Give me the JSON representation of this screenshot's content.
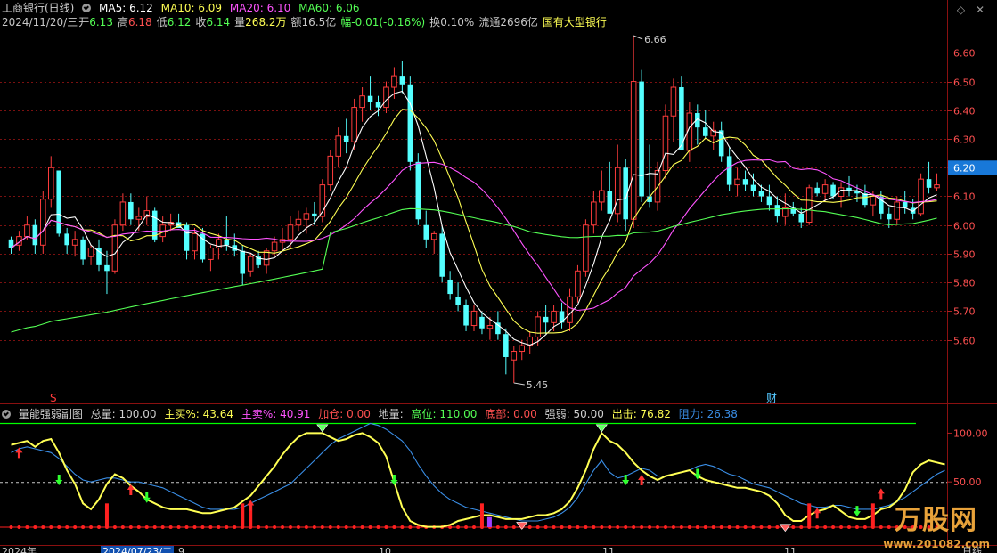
{
  "header": {
    "name": "工商银行(日线)",
    "ma5": "MA5: 6.12",
    "ma10": "MA10: 6.09",
    "ma20": "MA20: 6.10",
    "ma60": "MA60: 6.06",
    "date": "2024/11/20/三",
    "open_label": "开",
    "open": "6.13",
    "high_label": "高",
    "high": "6.18",
    "low_label": "低",
    "low": "6.12",
    "close_label": "收",
    "close": "6.14",
    "vol_label": "量",
    "vol": "268.2万",
    "amt_label": "额",
    "amt": "16.5亿",
    "chg_label": "幅",
    "chg": "-0.01(-0.16%)",
    "turn_label": "换",
    "turn": "0.10%",
    "float_label": "流通",
    "float": "2696亿",
    "tag": "国有大型银行"
  },
  "sub_header": {
    "name": "量能强弱副图",
    "total": "总量: 100.00",
    "main_buy": "主买%: 43.64",
    "main_sell": "主卖%: 40.91",
    "add": "加仓: 0.00",
    "ground": "地量:",
    "high_pos": "高位: 110.00",
    "bottom": "底部: 0.00",
    "strength": "强弱: 50.00",
    "exit": "出击: 76.82",
    "resist": "阻力: 26.38"
  },
  "markers": {
    "s": "S",
    "cai": "财",
    "hi": "6.66",
    "lo": "5.45",
    "price_tag": "6.20"
  },
  "axis_bottom": {
    "year": "2024年",
    "sel_date": "2024/07/23/二",
    "m9": "9",
    "m10": "10",
    "m11": "11",
    "period": "日线"
  },
  "watermark": {
    "brand": "万股网",
    "url": "www.201082.com"
  },
  "icons": {
    "diamond": "diamond-icon",
    "close": "close-icon",
    "settings": "circle-check-icon"
  },
  "colors": {
    "up": "#ff3c3c",
    "down": "#54ffff",
    "ma5": "#ffffff",
    "ma10": "#ffff54",
    "ma20": "#ff54ff",
    "ma60": "#54ff54",
    "strength": "#ffff54",
    "blue": "#3a8ee6",
    "green_line": "#00ff00"
  },
  "chart_data": {
    "type": "candlestick",
    "y_ticks": [
      6.6,
      6.5,
      6.4,
      6.3,
      6.2,
      6.1,
      6.0,
      5.9,
      5.8,
      5.7,
      5.6
    ],
    "y_range": [
      5.45,
      6.66
    ],
    "sub_y_ticks": [
      "100.00",
      "50.00"
    ],
    "sub_y_range": [
      0,
      110
    ],
    "candles": [
      [
        5.95,
        5.96,
        5.9,
        5.92
      ],
      [
        5.93,
        5.98,
        5.91,
        5.96
      ],
      [
        5.96,
        6.03,
        5.95,
        6.0
      ],
      [
        6.0,
        6.02,
        5.9,
        5.93
      ],
      [
        5.93,
        6.12,
        5.9,
        6.09
      ],
      [
        6.09,
        6.24,
        6.06,
        6.2
      ],
      [
        6.19,
        6.19,
        5.96,
        5.97
      ],
      [
        5.97,
        5.99,
        5.9,
        5.93
      ],
      [
        5.93,
        5.98,
        5.89,
        5.95
      ],
      [
        5.95,
        5.96,
        5.86,
        5.88
      ],
      [
        5.89,
        5.93,
        5.86,
        5.92
      ],
      [
        5.92,
        5.95,
        5.84,
        5.86
      ],
      [
        5.86,
        5.91,
        5.76,
        5.84
      ],
      [
        5.84,
        6.02,
        5.83,
        6.0
      ],
      [
        6.0,
        6.11,
        5.98,
        6.08
      ],
      [
        6.08,
        6.11,
        6.0,
        6.02
      ],
      [
        6.02,
        6.06,
        5.98,
        6.03
      ],
      [
        6.03,
        6.1,
        6.0,
        6.05
      ],
      [
        6.05,
        6.06,
        5.94,
        5.95
      ],
      [
        5.96,
        6.03,
        5.94,
        6.0
      ],
      [
        6.0,
        6.04,
        5.98,
        6.01
      ],
      [
        6.01,
        6.04,
        5.99,
        5.99
      ],
      [
        6.0,
        6.01,
        5.88,
        5.91
      ],
      [
        5.91,
        5.99,
        5.88,
        5.97
      ],
      [
        5.97,
        5.99,
        5.87,
        5.88
      ],
      [
        5.88,
        5.93,
        5.84,
        5.92
      ],
      [
        5.92,
        5.97,
        5.88,
        5.95
      ],
      [
        5.95,
        6.03,
        5.91,
        5.93
      ],
      [
        5.93,
        5.97,
        5.89,
        5.91
      ],
      [
        5.91,
        5.93,
        5.79,
        5.83
      ],
      [
        5.84,
        5.9,
        5.82,
        5.89
      ],
      [
        5.89,
        5.91,
        5.85,
        5.86
      ],
      [
        5.86,
        5.92,
        5.83,
        5.91
      ],
      [
        5.91,
        5.96,
        5.89,
        5.94
      ],
      [
        5.94,
        5.99,
        5.91,
        5.95
      ],
      [
        5.95,
        6.03,
        5.92,
        6.0
      ],
      [
        6.0,
        6.05,
        5.98,
        6.02
      ],
      [
        6.02,
        6.06,
        5.97,
        6.04
      ],
      [
        6.04,
        6.08,
        6.0,
        6.03
      ],
      [
        6.03,
        6.16,
        6.01,
        6.14
      ],
      [
        6.14,
        6.26,
        6.12,
        6.24
      ],
      [
        6.24,
        6.34,
        6.2,
        6.31
      ],
      [
        6.31,
        6.37,
        6.25,
        6.29
      ],
      [
        6.29,
        6.44,
        6.26,
        6.41
      ],
      [
        6.41,
        6.48,
        6.36,
        6.45
      ],
      [
        6.45,
        6.52,
        6.4,
        6.43
      ],
      [
        6.43,
        6.45,
        6.38,
        6.41
      ],
      [
        6.41,
        6.5,
        6.39,
        6.48
      ],
      [
        6.48,
        6.55,
        6.44,
        6.52
      ],
      [
        6.52,
        6.57,
        6.46,
        6.49
      ],
      [
        6.49,
        6.52,
        6.19,
        6.22
      ],
      [
        6.22,
        6.25,
        6.0,
        6.02
      ],
      [
        6.0,
        6.05,
        5.92,
        5.95
      ],
      [
        5.95,
        5.98,
        5.9,
        5.97
      ],
      [
        5.97,
        6.0,
        5.8,
        5.82
      ],
      [
        5.81,
        5.84,
        5.74,
        5.76
      ],
      [
        5.75,
        5.8,
        5.7,
        5.72
      ],
      [
        5.72,
        5.74,
        5.63,
        5.65
      ],
      [
        5.65,
        5.72,
        5.63,
        5.7
      ],
      [
        5.68,
        5.7,
        5.62,
        5.64
      ],
      [
        5.64,
        5.68,
        5.6,
        5.65
      ],
      [
        5.66,
        5.7,
        5.6,
        5.62
      ],
      [
        5.62,
        5.64,
        5.48,
        5.54
      ],
      [
        5.53,
        5.58,
        5.45,
        5.56
      ],
      [
        5.56,
        5.6,
        5.53,
        5.58
      ],
      [
        5.58,
        5.63,
        5.55,
        5.61
      ],
      [
        5.61,
        5.7,
        5.58,
        5.68
      ],
      [
        5.68,
        5.72,
        5.62,
        5.66
      ],
      [
        5.66,
        5.72,
        5.63,
        5.7
      ],
      [
        5.7,
        5.73,
        5.64,
        5.66
      ],
      [
        5.66,
        5.78,
        5.63,
        5.75
      ],
      [
        5.75,
        5.86,
        5.73,
        5.84
      ],
      [
        5.84,
        6.02,
        5.82,
        6.0
      ],
      [
        6.0,
        6.12,
        5.97,
        6.08
      ],
      [
        6.08,
        6.19,
        6.05,
        6.12
      ],
      [
        6.12,
        6.22,
        6.07,
        6.04
      ],
      [
        6.04,
        6.28,
        6.01,
        6.2
      ],
      [
        6.2,
        6.23,
        5.98,
        6.02
      ],
      [
        6.02,
        6.66,
        5.99,
        6.5
      ],
      [
        6.5,
        6.54,
        6.08,
        6.1
      ],
      [
        6.1,
        6.28,
        6.06,
        6.08
      ],
      [
        6.08,
        6.22,
        6.05,
        6.19
      ],
      [
        6.19,
        6.42,
        6.16,
        6.38
      ],
      [
        6.38,
        6.51,
        6.29,
        6.48
      ],
      [
        6.48,
        6.52,
        6.3,
        6.26
      ],
      [
        6.26,
        6.43,
        6.22,
        6.39
      ],
      [
        6.39,
        6.42,
        6.28,
        6.34
      ],
      [
        6.34,
        6.4,
        6.3,
        6.31
      ],
      [
        6.31,
        6.36,
        6.26,
        6.33
      ],
      [
        6.33,
        6.36,
        6.22,
        6.24
      ],
      [
        6.24,
        6.27,
        6.12,
        6.14
      ],
      [
        6.14,
        6.2,
        6.1,
        6.16
      ],
      [
        6.16,
        6.19,
        6.12,
        6.14
      ],
      [
        6.14,
        6.18,
        6.1,
        6.12
      ],
      [
        6.12,
        6.14,
        6.08,
        6.1
      ],
      [
        6.1,
        6.14,
        6.05,
        6.07
      ],
      [
        6.07,
        6.1,
        6.01,
        6.03
      ],
      [
        6.03,
        6.11,
        6.0,
        6.06
      ],
      [
        6.06,
        6.08,
        6.03,
        6.04
      ],
      [
        6.04,
        6.06,
        5.99,
        6.01
      ],
      [
        6.01,
        6.14,
        6.0,
        6.13
      ],
      [
        6.13,
        6.15,
        6.1,
        6.11
      ],
      [
        6.11,
        6.16,
        6.08,
        6.14
      ],
      [
        6.14,
        6.15,
        6.09,
        6.1
      ],
      [
        6.1,
        6.15,
        6.06,
        6.13
      ],
      [
        6.13,
        6.17,
        6.1,
        6.12
      ],
      [
        6.12,
        6.14,
        6.08,
        6.11
      ],
      [
        6.11,
        6.14,
        6.06,
        6.07
      ],
      [
        6.07,
        6.12,
        6.03,
        6.1
      ],
      [
        6.1,
        6.12,
        6.02,
        6.04
      ],
      [
        6.04,
        6.06,
        5.99,
        6.02
      ],
      [
        6.02,
        6.1,
        6.0,
        6.08
      ],
      [
        6.08,
        6.12,
        6.04,
        6.06
      ],
      [
        6.06,
        6.09,
        6.02,
        6.04
      ],
      [
        6.04,
        6.18,
        6.03,
        6.16
      ],
      [
        6.16,
        6.22,
        6.11,
        6.13
      ],
      [
        6.13,
        6.18,
        6.12,
        6.14
      ]
    ],
    "series": [
      {
        "name": "MA5",
        "values": []
      },
      {
        "name": "MA10",
        "values": []
      },
      {
        "name": "MA20",
        "values": []
      },
      {
        "name": "MA60",
        "values": []
      }
    ],
    "strength_line": [
      88,
      90,
      92,
      86,
      92,
      94,
      80,
      62,
      48,
      28,
      22,
      32,
      48,
      58,
      54,
      46,
      40,
      32,
      28,
      24,
      22,
      22,
      22,
      20,
      18,
      18,
      20,
      22,
      24,
      30,
      36,
      46,
      56,
      66,
      78,
      88,
      96,
      100,
      100,
      100,
      96,
      92,
      94,
      98,
      100,
      96,
      90,
      76,
      50,
      24,
      10,
      6,
      4,
      4,
      4,
      6,
      10,
      12,
      14,
      16,
      16,
      14,
      12,
      12,
      12,
      14,
      16,
      16,
      18,
      22,
      30,
      44,
      62,
      84,
      100,
      92,
      88,
      80,
      70,
      62,
      56,
      52,
      56,
      58,
      60,
      62,
      56,
      52,
      50,
      48,
      46,
      44,
      44,
      42,
      40,
      36,
      28,
      16,
      10,
      10,
      16,
      20,
      22,
      26,
      20,
      14,
      12,
      12,
      16,
      22,
      24,
      30,
      42,
      60,
      68,
      72,
      70,
      68
    ],
    "blue_line": [
      80,
      84,
      86,
      84,
      82,
      80,
      74,
      66,
      58,
      52,
      50,
      52,
      54,
      54,
      52,
      50,
      50,
      48,
      46,
      44,
      40,
      36,
      32,
      28,
      24,
      22,
      22,
      22,
      22,
      24,
      28,
      32,
      36,
      40,
      44,
      48,
      56,
      64,
      72,
      80,
      88,
      94,
      98,
      102,
      106,
      110,
      108,
      104,
      98,
      92,
      82,
      68,
      56,
      46,
      38,
      32,
      28,
      24,
      22,
      20,
      18,
      16,
      14,
      12,
      10,
      10,
      10,
      12,
      14,
      18,
      24,
      34,
      48,
      62,
      72,
      60,
      54,
      56,
      60,
      64,
      62,
      56,
      56,
      58,
      60,
      62,
      66,
      68,
      66,
      62,
      58,
      56,
      52,
      48,
      46,
      44,
      40,
      36,
      32,
      28,
      26,
      24,
      24,
      26,
      26,
      24,
      22,
      22,
      22,
      24,
      26,
      30,
      34,
      40,
      46,
      52,
      58,
      62
    ]
  }
}
